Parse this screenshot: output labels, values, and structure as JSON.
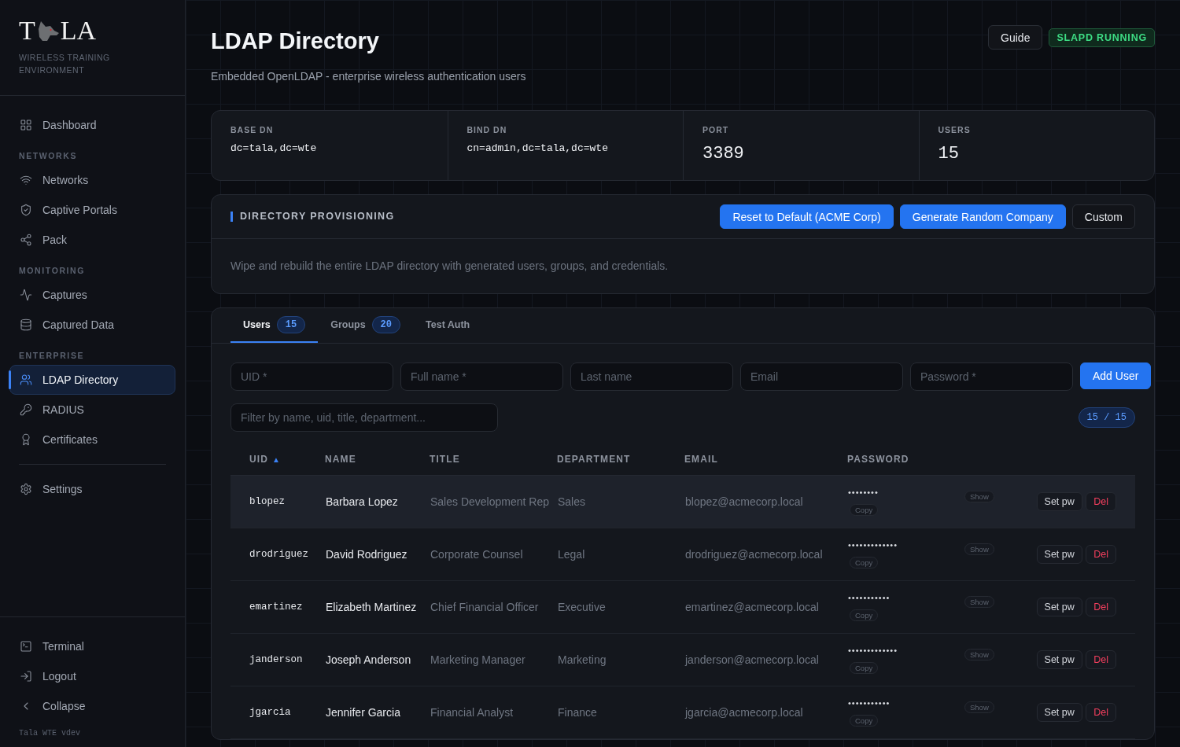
{
  "brand": {
    "logo_left": "T",
    "logo_right": "LA",
    "subtitle": "WIRELESS TRAINING ENVIRONMENT"
  },
  "sidebar": {
    "items": [
      {
        "kind": "item",
        "label": "Dashboard",
        "selected": false
      },
      {
        "kind": "section",
        "label": "NETWORKS"
      },
      {
        "kind": "item",
        "label": "Networks",
        "selected": false
      },
      {
        "kind": "item",
        "label": "Captive Portals",
        "selected": false
      },
      {
        "kind": "item",
        "label": "Pack",
        "selected": false
      },
      {
        "kind": "section",
        "label": "MONITORING"
      },
      {
        "kind": "item",
        "label": "Captures",
        "selected": false
      },
      {
        "kind": "item",
        "label": "Captured Data",
        "selected": false
      },
      {
        "kind": "section",
        "label": "ENTERPRISE"
      },
      {
        "kind": "item",
        "label": "LDAP Directory",
        "selected": true
      },
      {
        "kind": "item",
        "label": "RADIUS",
        "selected": false
      },
      {
        "kind": "item",
        "label": "Certificates",
        "selected": false
      },
      {
        "kind": "divider"
      },
      {
        "kind": "item",
        "label": "Settings",
        "selected": false
      }
    ],
    "footer_items": [
      {
        "label": "Terminal"
      },
      {
        "label": "Logout"
      },
      {
        "label": "Collapse"
      }
    ],
    "version": "Tala WTE vdev"
  },
  "header": {
    "title": "LDAP Directory",
    "subtitle": "Embedded OpenLDAP - enterprise wireless authentication users",
    "guide_button": "Guide",
    "status": "SLAPD RUNNING"
  },
  "stats": [
    {
      "label": "BASE DN",
      "value": "dc=tala,dc=wte",
      "kind": "small"
    },
    {
      "label": "BIND DN",
      "value": "cn=admin,dc=tala,dc=wte",
      "kind": "small"
    },
    {
      "label": "PORT",
      "value": "3389",
      "kind": "large"
    },
    {
      "label": "USERS",
      "value": "15",
      "kind": "large"
    }
  ],
  "provisioning": {
    "title": "DIRECTORY PROVISIONING",
    "buttons": [
      {
        "label": "Reset to Default (ACME Corp)",
        "kind": "primary"
      },
      {
        "label": "Generate Random Company",
        "kind": "primary"
      },
      {
        "label": "Custom",
        "kind": "secondary"
      }
    ],
    "description": "Wipe and rebuild the entire LDAP directory with generated users, groups, and credentials."
  },
  "tabs": [
    {
      "label": "Users",
      "count": "15",
      "selected": true
    },
    {
      "label": "Groups",
      "count": "20",
      "selected": false
    },
    {
      "label": "Test Auth",
      "selected": false
    }
  ],
  "add_user": {
    "fields": [
      {
        "placeholder": "UID *"
      },
      {
        "placeholder": "Full name *"
      },
      {
        "placeholder": "Last name"
      },
      {
        "placeholder": "Email"
      },
      {
        "placeholder": "Password *"
      }
    ],
    "button": "Add User"
  },
  "filter": {
    "placeholder": "Filter by name, uid, title, department...",
    "count": "15 / 15"
  },
  "table": {
    "columns": [
      {
        "label": "UID",
        "sort_mark": "▲"
      },
      {
        "label": "NAME"
      },
      {
        "label": "TITLE"
      },
      {
        "label": "DEPARTMENT"
      },
      {
        "label": "EMAIL"
      },
      {
        "label": "PASSWORD"
      }
    ],
    "rows": [
      {
        "uid": "blopez",
        "name": "Barbara Lopez",
        "title": "Sales Development Rep",
        "department": "Sales",
        "email": "blopez@acmecorp.local",
        "password": "••••••••",
        "selected": true,
        "show": "Show",
        "copy": "Copy",
        "set_pw": "Set pw",
        "delete": "Del"
      },
      {
        "uid": "drodriguez",
        "name": "David Rodriguez",
        "title": "Corporate Counsel",
        "department": "Legal",
        "email": "drodriguez@acmecorp.local",
        "password": "•••••••••••••",
        "selected": false,
        "show": "Show",
        "copy": "Copy",
        "set_pw": "Set pw",
        "delete": "Del"
      },
      {
        "uid": "emartinez",
        "name": "Elizabeth Martinez",
        "title": "Chief Financial Officer",
        "department": "Executive",
        "email": "emartinez@acmecorp.local",
        "password": "•••••••••••",
        "selected": false,
        "show": "Show",
        "copy": "Copy",
        "set_pw": "Set pw",
        "delete": "Del"
      },
      {
        "uid": "janderson",
        "name": "Joseph Anderson",
        "title": "Marketing Manager",
        "department": "Marketing",
        "email": "janderson@acmecorp.local",
        "password": "•••••••••••••",
        "selected": false,
        "show": "Show",
        "copy": "Copy",
        "set_pw": "Set pw",
        "delete": "Del"
      },
      {
        "uid": "jgarcia",
        "name": "Jennifer Garcia",
        "title": "Financial Analyst",
        "department": "Finance",
        "email": "jgarcia@acmecorp.local",
        "password": "•••••••••••",
        "selected": false,
        "show": "Show",
        "copy": "Copy",
        "set_pw": "Set pw",
        "delete": "Del"
      }
    ]
  }
}
